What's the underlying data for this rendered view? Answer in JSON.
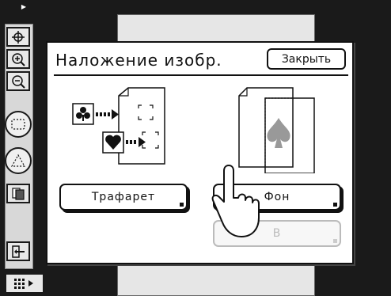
{
  "dialog": {
    "title": "Наложение изобр.",
    "close_label": "Закрыть"
  },
  "options": {
    "stencil_label": "Трафарет",
    "background_label": "Фон",
    "hidden_label": "В"
  },
  "icons": {
    "toolbar": [
      "move-icon",
      "zoom-in-icon",
      "zoom-out-icon",
      "area-select-icon",
      "point-select-icon",
      "pages-icon",
      "exit-icon",
      "grid-menu-icon"
    ],
    "stencil_illustration": [
      "club-icon",
      "heart-icon"
    ],
    "background_illustration": [
      "spade-icon"
    ],
    "pointer": "hand-pointer-icon"
  },
  "colors": {
    "background": "#1a1a1a",
    "paper": "#e6e6e6",
    "dialog": "#ffffff",
    "text": "#111111",
    "disabled": "#bbbbbb"
  }
}
